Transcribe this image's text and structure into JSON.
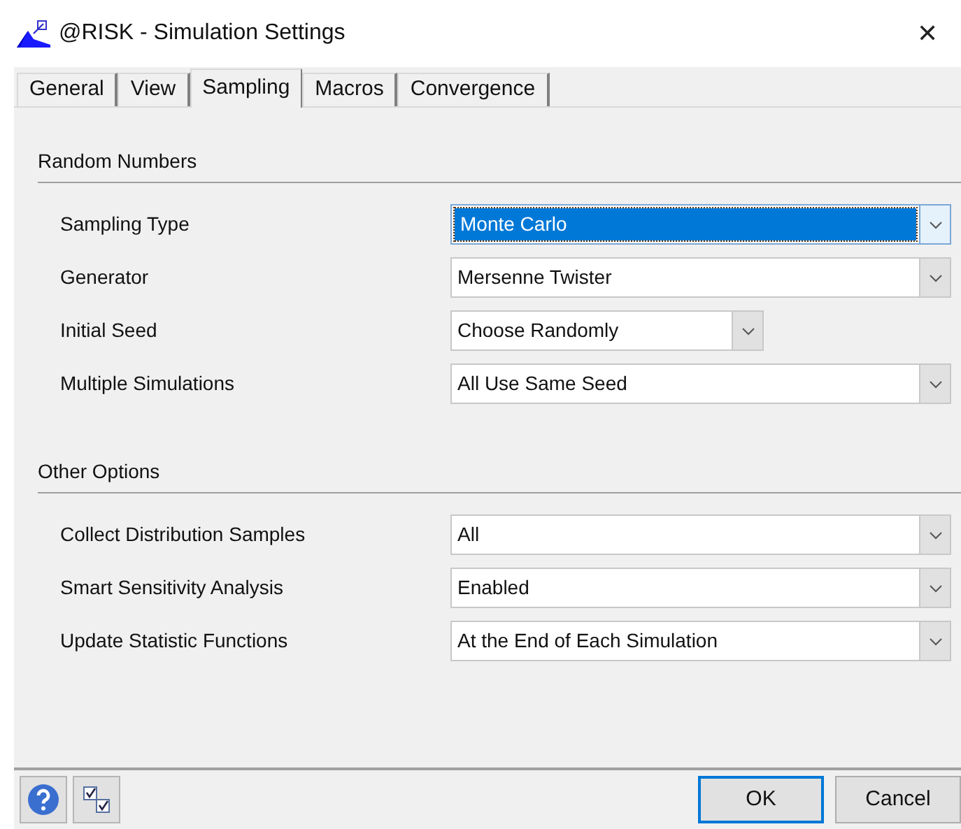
{
  "window": {
    "title": "@RISK - Simulation Settings",
    "close": "✕"
  },
  "tabs": [
    {
      "label": "General",
      "selected": false
    },
    {
      "label": "View",
      "selected": false
    },
    {
      "label": "Sampling",
      "selected": true
    },
    {
      "label": "Macros",
      "selected": false
    },
    {
      "label": "Convergence",
      "selected": false
    }
  ],
  "sections": [
    {
      "heading": "Random Numbers",
      "rows": [
        {
          "label": "Sampling Type",
          "value": "Monte Carlo",
          "kind": "wide",
          "focused": true
        },
        {
          "label": "Generator",
          "value": "Mersenne Twister",
          "kind": "wide",
          "focused": false
        },
        {
          "label": "Initial Seed",
          "value": "Choose Randomly",
          "kind": "narrow",
          "focused": false
        },
        {
          "label": "Multiple Simulations",
          "value": "All Use Same Seed",
          "kind": "wide",
          "focused": false
        }
      ]
    },
    {
      "heading": "Other Options",
      "rows": [
        {
          "label": "Collect Distribution Samples",
          "value": "All",
          "kind": "wide",
          "focused": false
        },
        {
          "label": "Smart Sensitivity Analysis",
          "value": "Enabled",
          "kind": "wide",
          "focused": false
        },
        {
          "label": "Update Statistic Functions",
          "value": "At the End of Each Simulation",
          "kind": "wide",
          "focused": false
        }
      ]
    }
  ],
  "buttons": [
    {
      "label": "OK",
      "default": true
    },
    {
      "label": "Cancel",
      "default": false
    }
  ]
}
